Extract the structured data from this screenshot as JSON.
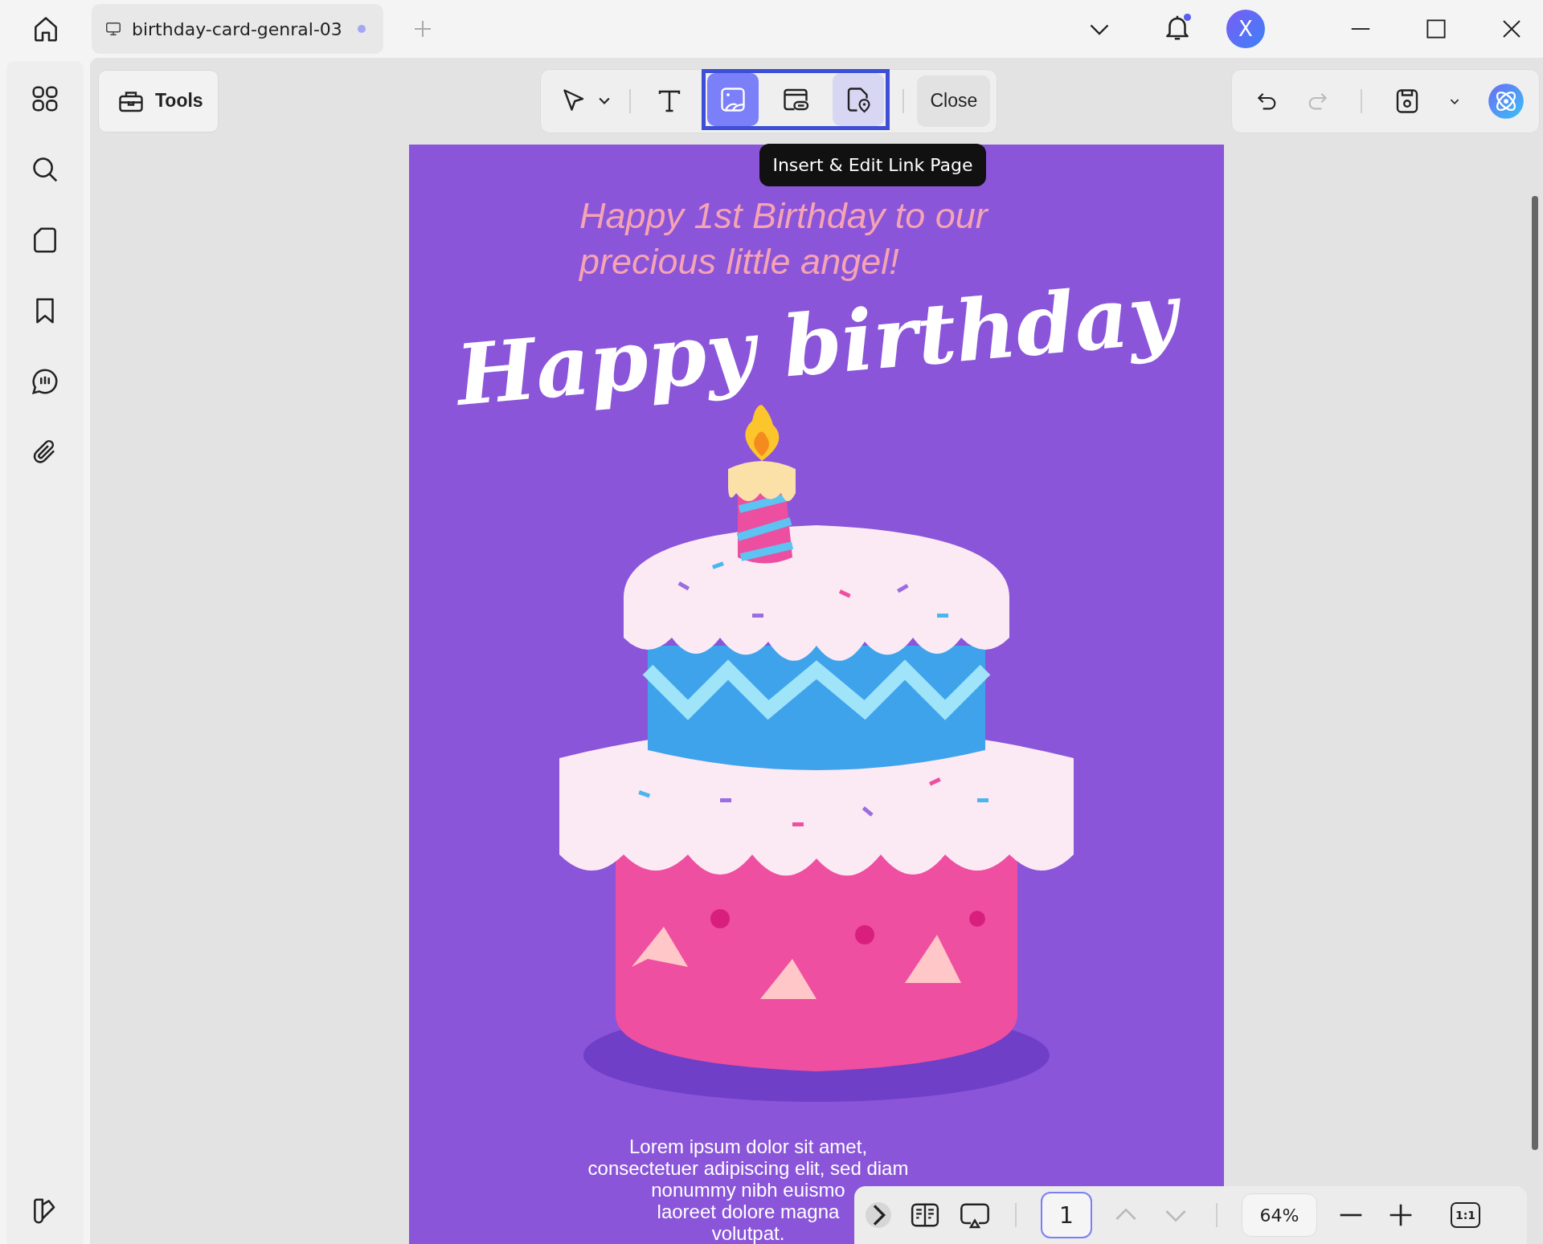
{
  "tab": {
    "title": "birthday-card-genral-03",
    "unsaved": true
  },
  "notifications": {
    "unread": true
  },
  "user": {
    "initial": "X"
  },
  "tools_button": {
    "label": "Tools"
  },
  "edit_toolbar": {
    "tools": [
      {
        "kind": "select",
        "selected": false,
        "hovered": false
      },
      {
        "kind": "text",
        "selected": false,
        "hovered": false
      }
    ],
    "highlighted_tools": [
      {
        "kind": "image",
        "selected": true,
        "hovered": false
      },
      {
        "kind": "link",
        "selected": false,
        "hovered": false
      },
      {
        "kind": "page_link",
        "selected": false,
        "hovered": true
      }
    ],
    "close": "Close"
  },
  "tooltip": "Insert & Edit Link Page",
  "history": [
    {
      "kind": "undo",
      "disabled": false
    },
    {
      "kind": "redo",
      "disabled": true
    }
  ],
  "document": {
    "greeting": "Happy 1st Birthday to our precious little angel!",
    "headline": "Happy birthday",
    "body_lines": [
      "Lorem ipsum dolor sit amet,",
      "consectetuer adipiscing elit, sed diam",
      "nonummy nibh euismo",
      "laoreet dolore magna",
      "volutpat."
    ]
  },
  "page_nav": {
    "page": "1",
    "prev_disabled": true,
    "next_disabled": true,
    "zoom": "64%",
    "zoom_reset": "1:1"
  }
}
